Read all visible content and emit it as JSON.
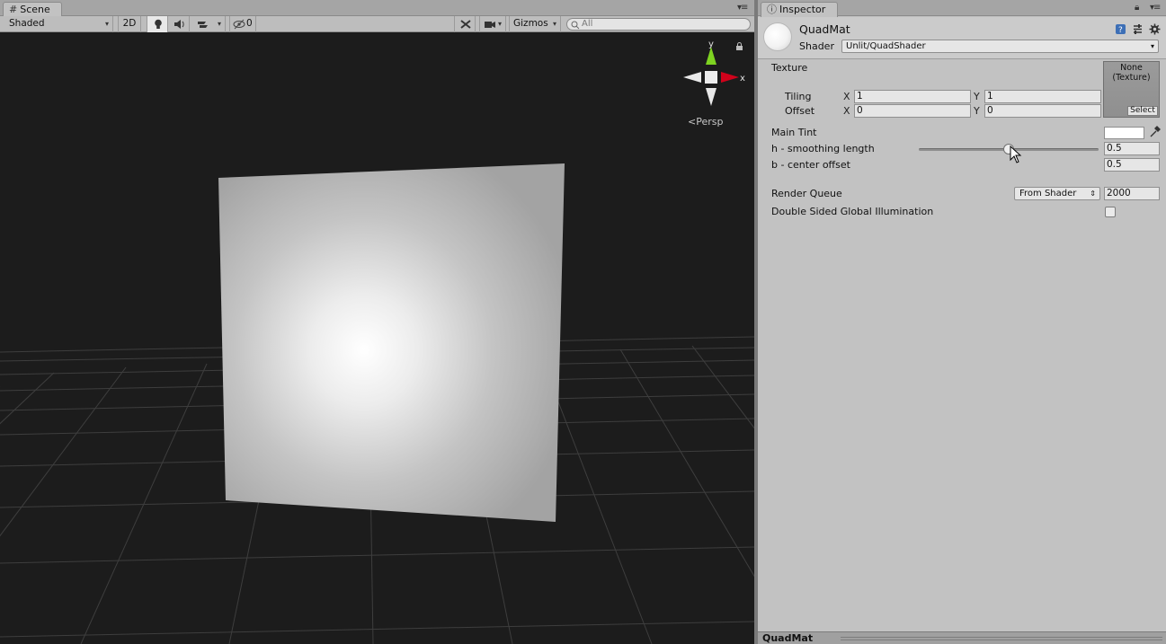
{
  "scene": {
    "tab_title": "Scene",
    "tab_icon": "hash-icon",
    "toolbar": {
      "draw_mode": "Shaded",
      "mode_2d": "2D",
      "lighting_icon": "lightbulb-icon",
      "audio_icon": "speaker-icon",
      "effects_icon": "effects-icon",
      "hidden_count": "0",
      "tools_icon": "tools-icon",
      "camera_icon": "camera-icon",
      "gizmos_label": "Gizmos",
      "search_placeholder": "All"
    },
    "gizmo": {
      "y_label": "y",
      "x_label": "x"
    },
    "projection_label": "Persp",
    "colors": {
      "background": "#1c1c1c",
      "grid": "#4a4a4a",
      "axis_y": "#7ed321",
      "axis_x": "#d0021b"
    }
  },
  "inspector": {
    "tab_title": "Inspector",
    "tab_icon": "info-icon",
    "material_name": "QuadMat",
    "shader_label": "Shader",
    "shader_value": "Unlit/QuadShader",
    "texture": {
      "label": "Texture",
      "slot_text_1": "None",
      "slot_text_2": "(Texture)",
      "select_label": "Select",
      "tiling_label": "Tiling",
      "offset_label": "Offset",
      "x_label": "X",
      "y_label": "Y",
      "tiling_x": "1",
      "tiling_y": "1",
      "offset_x": "0",
      "offset_y": "0"
    },
    "main_tint_label": "Main Tint",
    "main_tint_color": "#ffffff",
    "smoothing_label": "h - smoothing length",
    "smoothing_value": "0.5",
    "smoothing_fraction": 0.5,
    "center_offset_label": "b - center offset",
    "center_offset_value": "0.5",
    "render_queue_label": "Render Queue",
    "render_queue_mode": "From Shader",
    "render_queue_value": "2000",
    "double_sided_label": "Double Sided Global Illumination",
    "double_sided_checked": false,
    "footer_label": "QuadMat"
  }
}
